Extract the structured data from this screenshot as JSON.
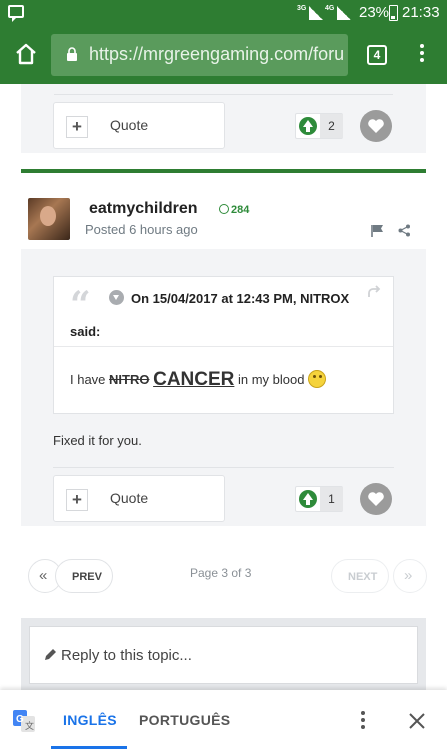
{
  "status_bar": {
    "signal_1_tag": "3G",
    "signal_2_tag": "4G",
    "battery": "23%",
    "time": "21:33"
  },
  "browser": {
    "url": "https://mrgreengaming.com/foru",
    "tab_count": "4"
  },
  "previous_post": {
    "quote_label": "Quote",
    "reputation": "2"
  },
  "post": {
    "username": "eatmychildren",
    "reputation": "284",
    "posted": "Posted 6 hours ago",
    "quote": {
      "cite": "On 15/04/2017 at 12:43 PM, NITROX",
      "said": "said:",
      "text_before": "I have ",
      "struck": "NITRO",
      "emphasis": "CANCER",
      "text_after": " in my blood "
    },
    "body": "Fixed it for you.",
    "quote_label": "Quote",
    "reputation_count": "1"
  },
  "pagination": {
    "prev": "PREV",
    "next": "NEXT",
    "page_info": "Page 3 of 3",
    "first_glyph": "«",
    "last_glyph": "»"
  },
  "reply": {
    "placeholder": "Reply to this topic..."
  },
  "translate_bar": {
    "lang_selected": "INGLÊS",
    "lang_other": "PORTUGUÊS"
  },
  "colors": {
    "brand_green": "#2e7d32",
    "upvote_green": "#2e8b3a",
    "translate_blue": "#1a73e8"
  }
}
